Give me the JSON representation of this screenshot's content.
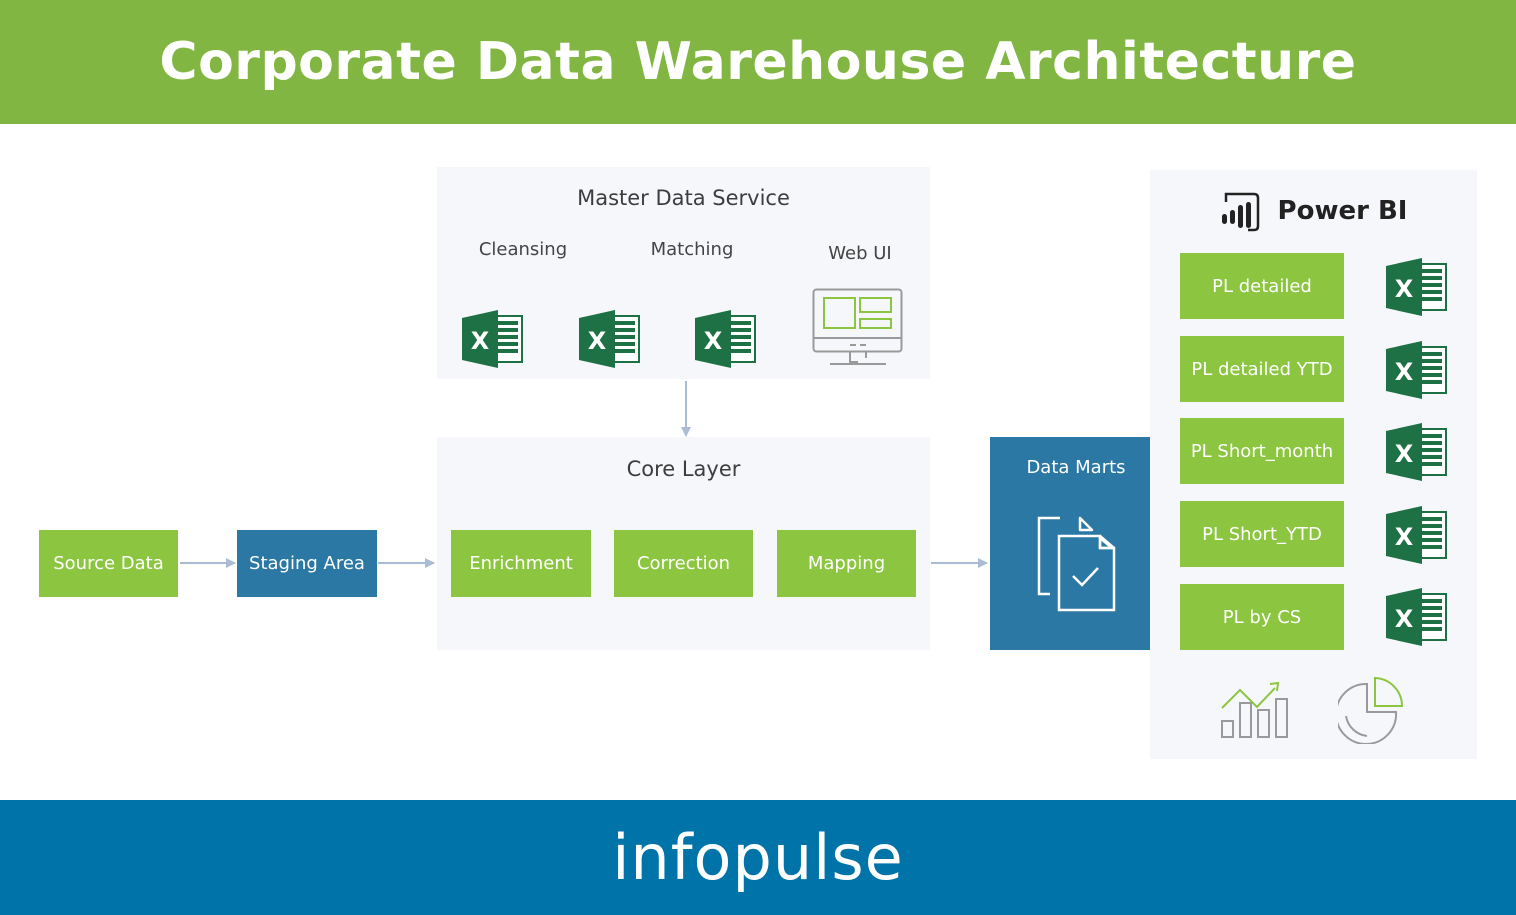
{
  "header": {
    "title": "Corporate Data Warehouse Architecture"
  },
  "footer": {
    "brand": "infopulse"
  },
  "flow": {
    "source": "Source Data",
    "staging": "Staging Area"
  },
  "master_data_service": {
    "title": "Master Data Service",
    "components": [
      {
        "label": "Cleansing",
        "icon": "excel-icon"
      },
      {
        "label": "Matching",
        "icon": "excel-icon"
      },
      {
        "label": "Web UI",
        "icon": "monitor-icon"
      }
    ]
  },
  "core_layer": {
    "title": "Core Layer",
    "steps": [
      "Enrichment",
      "Correction",
      "Mapping"
    ]
  },
  "data_marts": {
    "title": "Data Marts",
    "icon": "documents-check-icon"
  },
  "power_bi": {
    "title": "Power BI",
    "reports": [
      "PL detailed",
      "PL detailed YTD",
      "PL Short_month",
      "PL Short_YTD",
      "PL by CS"
    ],
    "bottom_icons": [
      "bar-chart-trend-icon",
      "pie-chart-icon"
    ]
  },
  "colors": {
    "header_green": "#82b642",
    "box_green": "#8cc540",
    "box_blue": "#2a78a3",
    "footer_blue": "#0073a8",
    "excel_green": "#1e7145",
    "arrow": "#a9bcd3",
    "panel_bg": "#f5f7fb"
  }
}
